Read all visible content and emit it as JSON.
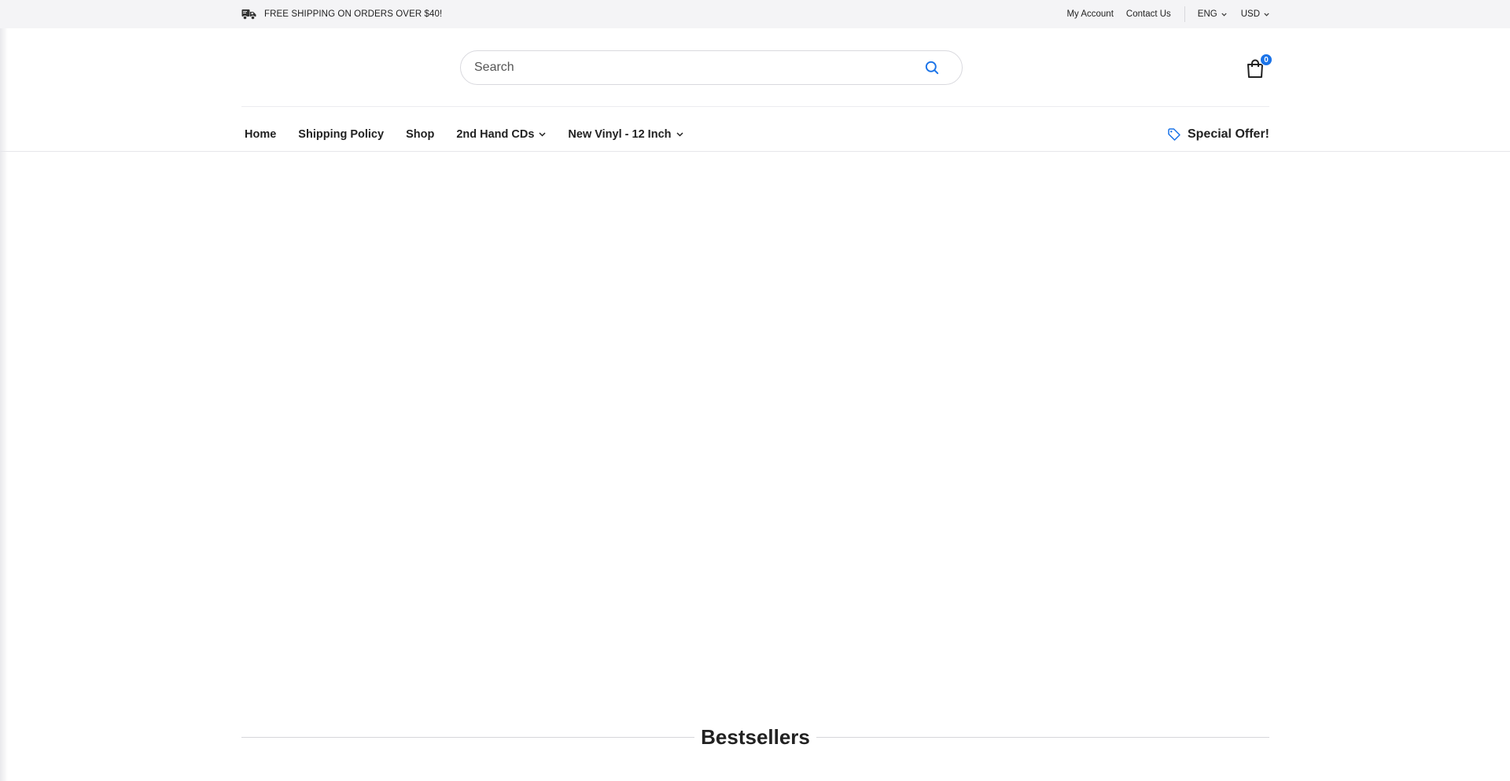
{
  "topbar": {
    "promo_text": "FREE SHIPPING ON ORDERS OVER $40!",
    "promo_icon": "truck-icon",
    "my_account": "My Account",
    "contact_us": "Contact Us",
    "language": "ENG",
    "currency": "USD"
  },
  "header": {
    "search_placeholder": "Search",
    "search_icon": "search-icon",
    "cart_icon": "shopping-bag-icon",
    "cart_count": "0"
  },
  "nav": {
    "items": [
      {
        "label": "Home",
        "has_dropdown": false
      },
      {
        "label": "Shipping Policy",
        "has_dropdown": false
      },
      {
        "label": "Shop",
        "has_dropdown": false
      },
      {
        "label": "2nd Hand CDs",
        "has_dropdown": true
      },
      {
        "label": "New Vinyl - 12 Inch",
        "has_dropdown": true
      }
    ],
    "special_offer": "Special Offer!",
    "special_offer_icon": "tag-icon"
  },
  "main": {
    "section_title": "Bestsellers"
  },
  "colors": {
    "accent": "#1a73e8",
    "topbar_bg": "#f4f4f6",
    "text": "#222222"
  }
}
